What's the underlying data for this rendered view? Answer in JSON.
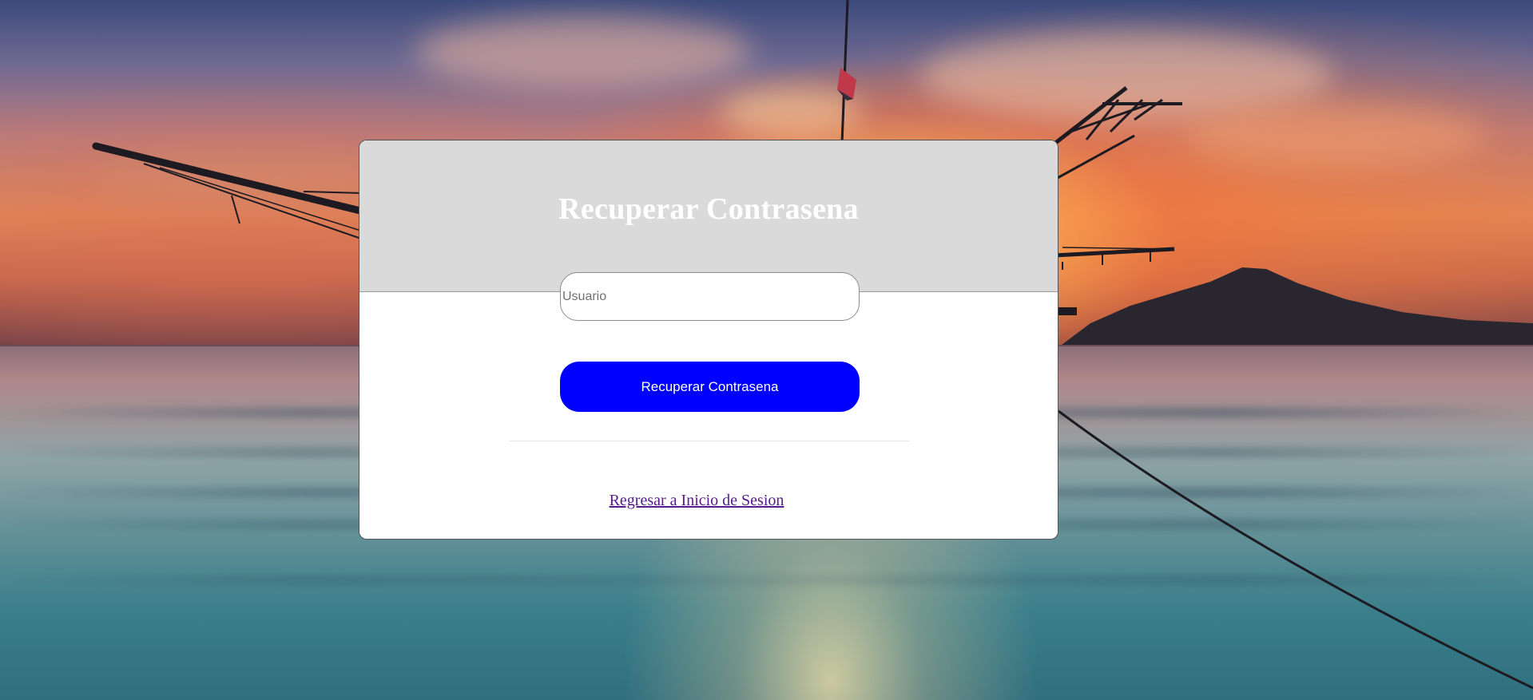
{
  "card": {
    "title": "Recuperar Contrasena",
    "username_placeholder": "Usuario",
    "username_value": "",
    "submit_label": "Recuperar Contrasena",
    "back_link_label": "Regresar a Inicio de Sesion"
  },
  "colors": {
    "header_background": "#dadada",
    "title_text": "#ffffff",
    "button_background": "#0000ff",
    "button_text": "#ffffff",
    "link_visited": "#551a8b",
    "card_background": "#ffffff"
  },
  "background": {
    "description_icon": "sunset-beach-photo"
  }
}
